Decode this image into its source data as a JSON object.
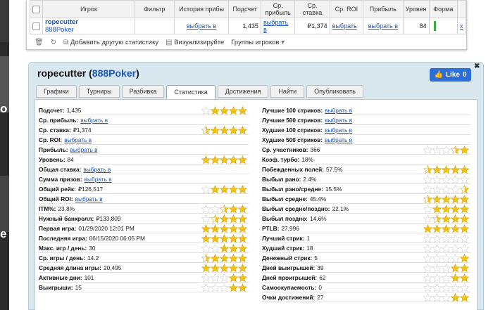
{
  "top_table": {
    "headers": [
      "Игрок",
      "Фильтр",
      "История прибы",
      "Подсчет",
      "Ср. прибыль",
      "Ср. ставка",
      "Ср. ROI",
      "Прибыль",
      "Уровен",
      "Форма"
    ],
    "row": {
      "player_name": "ropecutter",
      "player_site": "888Poker",
      "history": "выбрать в",
      "count": "1,435",
      "avg_profit": "выбрать в",
      "avg_stake": "₽1,374",
      "avg_roi": "выбрать",
      "profit": "выбрать в",
      "level": "84",
      "remove": "x"
    },
    "toolbar": {
      "add_stat": "Добавить другую статистику",
      "visualize": "Визуализируйте",
      "groups": "Группы игроков"
    }
  },
  "panel": {
    "player_name": "ropecutter",
    "site_open": "(",
    "site": "888Poker",
    "site_close": ")",
    "like_label": "Like",
    "like_count": "0",
    "close": "✖",
    "tabs": [
      "Графики",
      "Турниры",
      "Разбивка",
      "Статистика",
      "Достижения",
      "Найти",
      "Опубликовать"
    ],
    "active_tab": "Статистика"
  },
  "left_stats": [
    {
      "label": "Подсчет:",
      "value": "1,435",
      "link": false,
      "stars": 4
    },
    {
      "label": "Ср. прибыль:",
      "value": "выбрать в",
      "link": true,
      "stars": null
    },
    {
      "label": "Ср. ставка:",
      "value": "₽1,374",
      "link": false,
      "stars": 4.5
    },
    {
      "label": "Ср. ROI:",
      "value": "выбрать в",
      "link": true,
      "stars": null
    },
    {
      "label": "Прибыль:",
      "value": "выбрать в",
      "link": true,
      "stars": null
    },
    {
      "label": "Уровень:",
      "value": "84",
      "link": false,
      "stars": 5
    },
    {
      "label": "Общая ставка:",
      "value": "выбрать в",
      "link": true,
      "stars": null
    },
    {
      "label": "Сумма призов:",
      "value": "выбрать в",
      "link": true,
      "stars": null
    },
    {
      "label": "Общий рейк:",
      "value": "₽126,517",
      "link": false,
      "stars": 4
    },
    {
      "label": "Общий ROI:",
      "value": "выбрать в",
      "link": true,
      "stars": null
    },
    {
      "label": "ITM%:",
      "value": "23.8%",
      "link": false,
      "stars": 2.5
    },
    {
      "label": "Нужный банкролл:",
      "value": "₽133,809",
      "link": false,
      "stars": 3.5
    },
    {
      "label": "Первая игра:",
      "value": "01/29/2020 12:01 PM",
      "link": false,
      "stars": 5
    },
    {
      "label": "Последняя игра:",
      "value": "06/15/2020 06:05 PM",
      "link": false,
      "stars": 5
    },
    {
      "label": "Макс. игр / день:",
      "value": "30",
      "link": false,
      "stars": 3
    },
    {
      "label": "Ср. игры / день:",
      "value": "14.2",
      "link": false,
      "stars": 4.5
    },
    {
      "label": "Средняя длина игры:",
      "value": "20,495",
      "link": false,
      "stars": 5
    },
    {
      "label": "Активные дни:",
      "value": "101",
      "link": false,
      "stars": 2
    },
    {
      "label": "Выигрыши:",
      "value": "15",
      "link": false,
      "stars": 2
    }
  ],
  "right_stats": [
    {
      "label": "Лучшие 100 стриков:",
      "value": "выбрать в",
      "link": true,
      "stars": null
    },
    {
      "label": "Лучшие 500 стриков:",
      "value": "выбрать в",
      "link": true,
      "stars": null
    },
    {
      "label": "Худшие 100 стриков:",
      "value": "выбрать в",
      "link": true,
      "stars": null
    },
    {
      "label": "Худшие 500 стриков:",
      "value": "выбрать в",
      "link": true,
      "stars": null
    },
    {
      "label": "Ср. участников:",
      "value": "366",
      "link": false,
      "stars": 1.5
    },
    {
      "label": "Коэф. турбо:",
      "value": "18%",
      "link": false,
      "stars": null
    },
    {
      "label": "Побежденных полей:",
      "value": "57.5%",
      "link": false,
      "stars": 4.5
    },
    {
      "label": "Выбыл рано:",
      "value": "2.4%",
      "link": false,
      "stars": 0
    },
    {
      "label": "Выбыл рано/средне:",
      "value": "15.5%",
      "link": false,
      "stars": 0.5
    },
    {
      "label": "Выбыл средне:",
      "value": "45.4%",
      "link": false,
      "stars": 4.5
    },
    {
      "label": "Выбыл средне/поздно:",
      "value": "22.1%",
      "link": false,
      "stars": 4
    },
    {
      "label": "Выбыл поздно:",
      "value": "14.6%",
      "link": false,
      "stars": 3.5
    },
    {
      "label": "PTLB:",
      "value": "27,996",
      "link": false,
      "stars": 5
    },
    {
      "label": "Лучший стрик:",
      "value": "1",
      "link": false,
      "stars": 0
    },
    {
      "label": "Худший стрик:",
      "value": "18",
      "link": false,
      "stars": 0
    },
    {
      "label": "Денежный стрик:",
      "value": "5",
      "link": false,
      "stars": 1
    },
    {
      "label": "Дней выигрышей:",
      "value": "39",
      "link": false,
      "stars": 2
    },
    {
      "label": "Дней проигрышей:",
      "value": "62",
      "link": false,
      "stars": 2
    },
    {
      "label": "Самоокупаемость:",
      "value": "0",
      "link": false,
      "stars": 0
    },
    {
      "label": "Очки достижений:",
      "value": "27",
      "link": false,
      "stars": 2
    }
  ],
  "colors": {
    "star_gold": "#f2c21b",
    "star_empty": "#ffffff",
    "link": "#1a56b8",
    "panel_bg": "#d9e8ef",
    "like_bg": "#2b6fd6"
  }
}
